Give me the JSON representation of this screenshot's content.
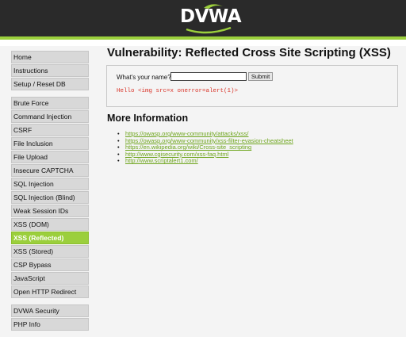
{
  "header": {
    "logo_text": "DVWA"
  },
  "sidebar": {
    "groups": [
      {
        "items": [
          "Home",
          "Instructions",
          "Setup / Reset DB"
        ]
      },
      {
        "items": [
          "Brute Force",
          "Command Injection",
          "CSRF",
          "File Inclusion",
          "File Upload",
          "Insecure CAPTCHA",
          "SQL Injection",
          "SQL Injection (Blind)",
          "Weak Session IDs",
          "XSS (DOM)",
          "XSS (Reflected)",
          "XSS (Stored)",
          "CSP Bypass",
          "JavaScript",
          "Open HTTP Redirect"
        ]
      },
      {
        "items": [
          "DVWA Security",
          "PHP Info"
        ]
      }
    ],
    "active": "XSS (Reflected)"
  },
  "main": {
    "title": "Vulnerability: Reflected Cross Site Scripting (XSS)",
    "form": {
      "label": "What's your name?",
      "input_value": "",
      "submit_label": "Submit"
    },
    "output": "Hello <img src=x onerror=alert(1)>",
    "more_title": "More Information",
    "links": [
      "https://owasp.org/www-community/attacks/xss/",
      "https://owasp.org/www-community/xss-filter-evasion-cheatsheet",
      "https://en.wikipedia.org/wiki/Cross-site_scripting",
      "http://www.cgisecurity.com/xss-faq.html",
      "http://www.scriptalert1.com/"
    ]
  },
  "colors": {
    "accent": "#9bcf3c",
    "header_bg": "#2a2a2a",
    "output_text": "#d9352a",
    "link": "#6ea51d"
  }
}
